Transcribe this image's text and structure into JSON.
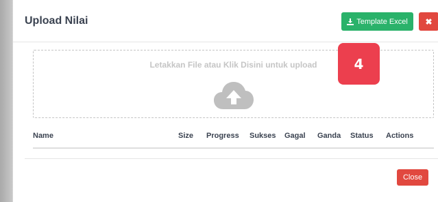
{
  "modal": {
    "title": "Upload Nilai",
    "template_button_label": "Template Excel",
    "close_x_label": "✖",
    "close_button_label": "Close"
  },
  "badge": {
    "number": "4"
  },
  "dropzone": {
    "text": "Letakkan File atau Klik Disini untuk upload",
    "icon": "cloud-upload-icon"
  },
  "table": {
    "columns": [
      "Name",
      "Size",
      "Progress",
      "Sukses",
      "Gagal",
      "Ganda",
      "Status",
      "Actions"
    ],
    "rows": []
  },
  "colors": {
    "success": "#2ab26a",
    "danger": "#e1483f",
    "badge": "#ec3f4e"
  }
}
